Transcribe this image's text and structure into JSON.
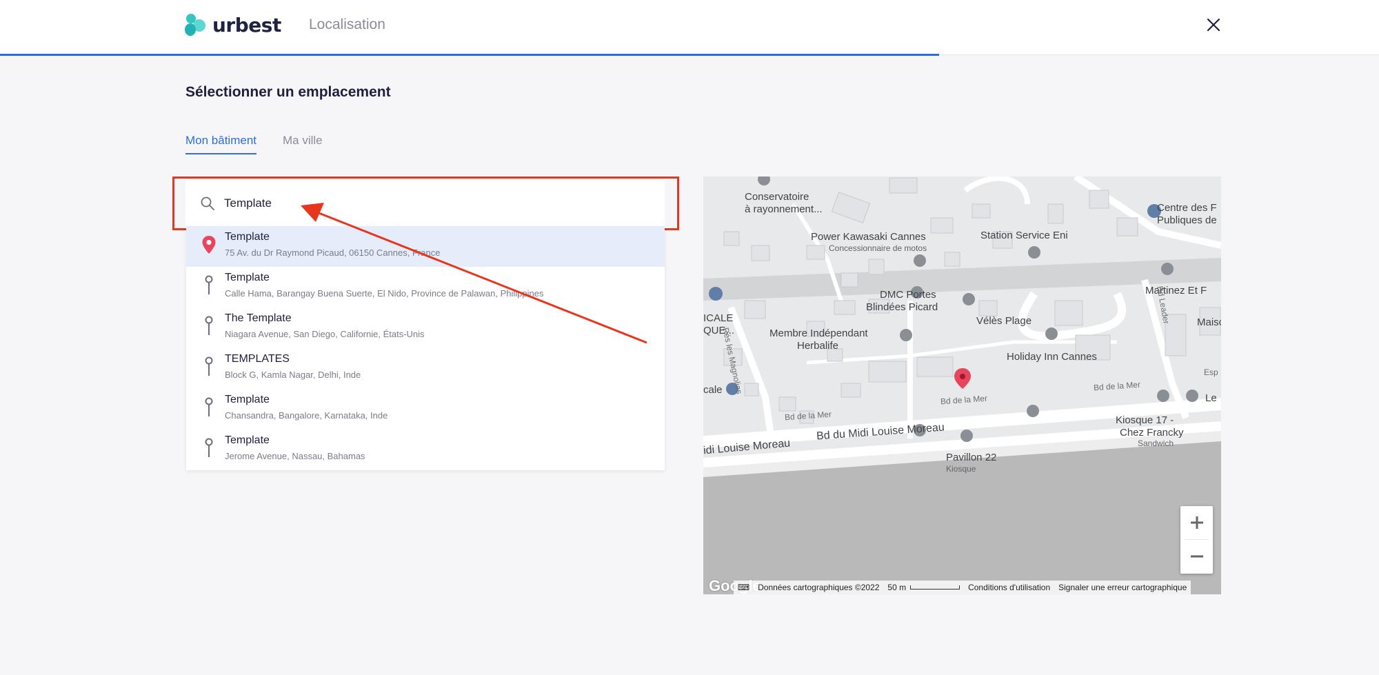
{
  "header": {
    "logo_text": "urbest",
    "title": "Localisation",
    "progress_fraction": 0.681
  },
  "section": {
    "title": "Sélectionner un emplacement"
  },
  "tabs": [
    {
      "label": "Mon bâtiment",
      "active": true
    },
    {
      "label": "Ma ville",
      "active": false
    }
  ],
  "search": {
    "value": "Template"
  },
  "results": [
    {
      "name": "Template",
      "address": "75 Av. du Dr Raymond Picaud, 06150 Cannes, France"
    },
    {
      "name": "Template",
      "address": "Calle Hama, Barangay Buena Suerte, El Nido, Province de Palawan, Philippines"
    },
    {
      "name": "The Template",
      "address": "Niagara Avenue, San Diego, Californie, États-Unis"
    },
    {
      "name": "TEMPLATES",
      "address": "Block G, Kamla Nagar, Delhi, Inde"
    },
    {
      "name": "Template",
      "address": "Chansandra, Bangalore, Karnataka, Inde"
    },
    {
      "name": "Template",
      "address": "Jerome Avenue, Nassau, Bahamas"
    }
  ],
  "map": {
    "labels": {
      "conservatoire": "Conservatoire",
      "conservatoire2": "à rayonnement...",
      "kawasaki": "Power Kawasaki Cannes",
      "kawasaki_sub": "Concessionnaire de motos",
      "station": "Station Service Eni",
      "centre1": "Centre des F",
      "centre2": "Publiques de",
      "dmc1": "DMC Portes",
      "dmc2": "Blindées Picard",
      "martinez": "Martinez Et F",
      "membre1": "Membre Indépendant",
      "membre2": "Herbalife",
      "veles": "Vélès Plage",
      "maiso": "Maiso",
      "holiday": "Holiday Inn Cannes",
      "icale1": "ICALE",
      "icale2": "QUE...",
      "cale": "cale",
      "kiosque1": "Kiosque 17 -",
      "kiosque2": "Chez Francky",
      "sandwich": "Sandwich",
      "le": "Le",
      "pavillon": "Pavillon 22",
      "kiosque_sub": "Kiosque",
      "bd_mer_1": "Bd de la Mer",
      "bd_mer_2": "Bd de la Mer",
      "bd_mer_3": "Bd de la Mer",
      "midi_left": "idi Louise Moreau",
      "midi_main": "Bd du Midi Louise Moreau",
      "magnolias": "Rés les Magnolias",
      "leader": "Bd Leader",
      "esp": "Esp"
    },
    "attribution": {
      "google": "Google",
      "data": "Données cartographiques ©2022",
      "scale": "50 m",
      "terms": "Conditions d'utilisation",
      "report": "Signaler une erreur cartographique"
    },
    "colors": {
      "land": "#e8e9ea",
      "road": "#ffffff",
      "sea": "#b9b9b9",
      "pin": "#e8445e"
    }
  },
  "colors": {
    "accent": "#2f6fd1",
    "annotation": "#e8361e",
    "selected_bg": "#e6edfa"
  }
}
